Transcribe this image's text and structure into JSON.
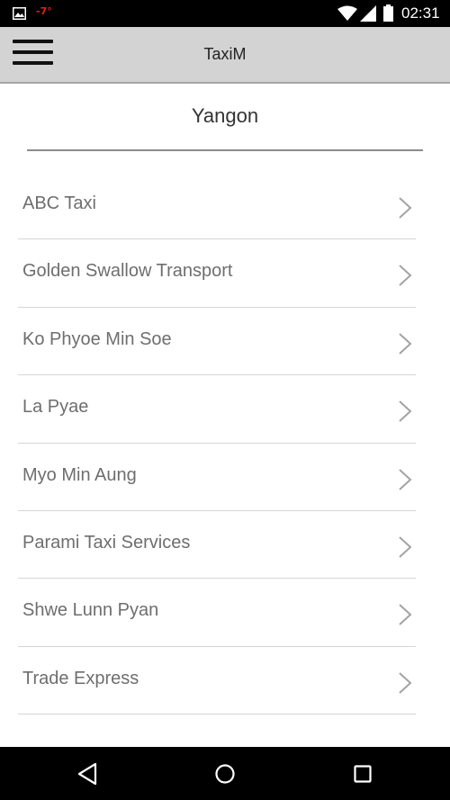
{
  "status_bar": {
    "temperature": "-7°",
    "time": "02:31",
    "icons": [
      "image-icon",
      "wifi-icon",
      "signal-icon",
      "battery-icon"
    ],
    "temperature_color": "#e0201a"
  },
  "app_bar": {
    "title": "TaxiM",
    "menu_icon": "hamburger-menu-icon",
    "background": "#d3d3d3"
  },
  "city": {
    "name": "Yangon"
  },
  "companies": [
    {
      "label": "ABC Taxi"
    },
    {
      "label": "Golden Swallow Transport"
    },
    {
      "label": "Ko Phyoe Min Soe"
    },
    {
      "label": "La Pyae"
    },
    {
      "label": "Myo Min Aung"
    },
    {
      "label": "Parami Taxi Services"
    },
    {
      "label": "Shwe Lunn Pyan"
    },
    {
      "label": "Trade Express"
    }
  ],
  "nav_bar": {
    "icons": [
      "back-icon",
      "home-icon",
      "recent-apps-icon"
    ]
  }
}
